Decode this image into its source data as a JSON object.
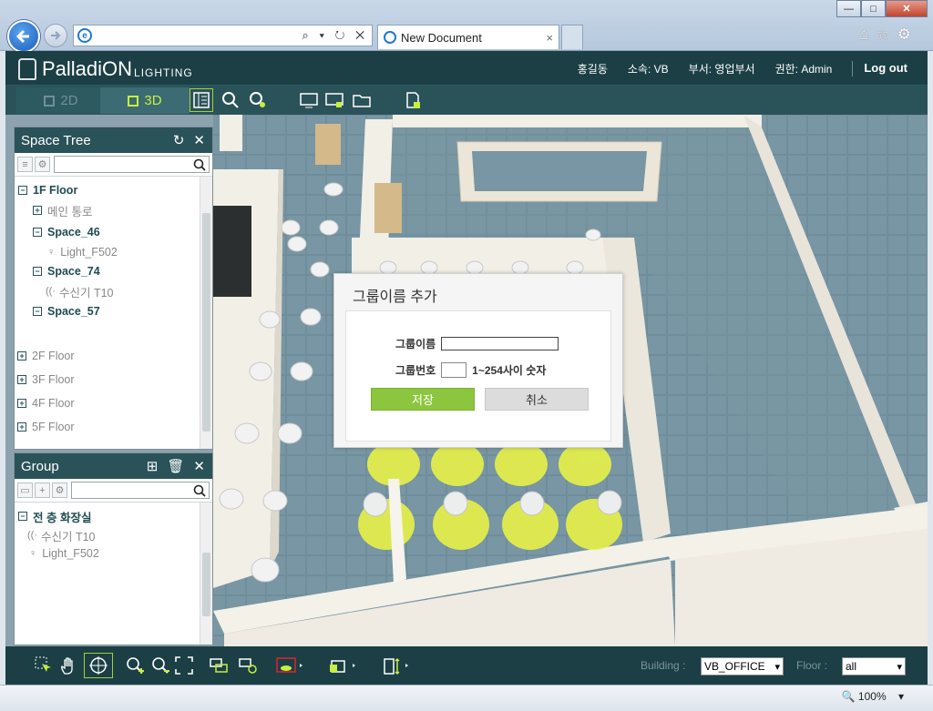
{
  "browser": {
    "tab_title": "New Document",
    "tab_close": "×",
    "win_min": "—",
    "win_max": "□",
    "win_close": "✕",
    "addr_tools": "⌕ ▾ ↻ ✕"
  },
  "header": {
    "logo_main": "PalladiON",
    "logo_sub": "LIGHTING",
    "user_name": "홍길동",
    "affiliation": "소속: VB",
    "department": "부서: 영업부서",
    "role": "권한: Admin",
    "logout": "Log out"
  },
  "view_tabs": {
    "tab_2d": "2D",
    "tab_3d": "3D"
  },
  "space_tree": {
    "title": "Space Tree",
    "items": [
      {
        "label": "1F Floor",
        "box": "−"
      },
      {
        "label": "메인 통로",
        "box": "+"
      },
      {
        "label": "Space_46",
        "box": "−"
      },
      {
        "label": "Light_F502"
      },
      {
        "label": "Space_74",
        "box": "−"
      },
      {
        "label": "수신기 T10"
      },
      {
        "label": "Space_57",
        "box": "−"
      },
      {
        "label": "2F Floor",
        "box": "+"
      },
      {
        "label": "3F Floor",
        "box": "+"
      },
      {
        "label": "4F Floor",
        "box": "+"
      },
      {
        "label": "5F Floor",
        "box": "+"
      }
    ]
  },
  "group_panel": {
    "title": "Group",
    "items": [
      {
        "label": "전 층 화장실",
        "box": "−"
      },
      {
        "label": "수신기 T10"
      },
      {
        "label": "Light_F502"
      }
    ]
  },
  "dialog": {
    "title": "그룹이름 추가",
    "name_label": "그룹이름",
    "number_label": "그룹번호",
    "number_hint": "1~254사이 숫자",
    "save": "저장",
    "cancel": "취소"
  },
  "bottom": {
    "building_label": "Building :",
    "building_value": "VB_OFFICE",
    "floor_label": "Floor :",
    "floor_value": "all"
  },
  "status": {
    "zoom": "100%"
  },
  "colors": {
    "accent": "#8cc63f",
    "header_bg": "#1b3f45",
    "highlight": "#c7ef3c"
  }
}
